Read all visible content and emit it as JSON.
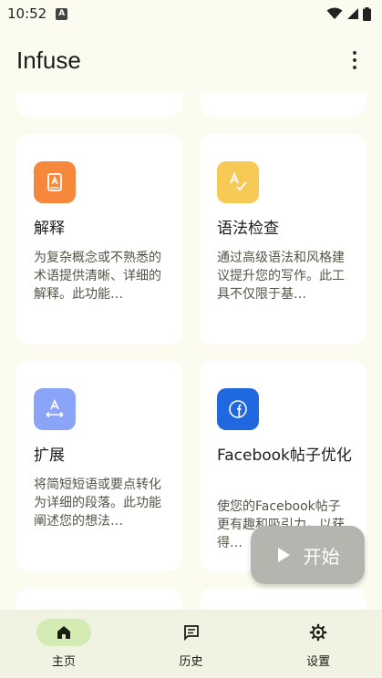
{
  "status_bar": {
    "time": "10:52",
    "notification_glyph": "A"
  },
  "app_bar": {
    "title": "Infuse",
    "menu_icon": "more-vert-icon"
  },
  "cards": [
    {
      "title": "解释",
      "description": "为复杂概念或不熟悉的术语提供清晰、详细的解释。此功能…",
      "icon": "book-icon",
      "icon_color": "#f6883b"
    },
    {
      "title": "语法检查",
      "description": "通过高级语法和风格建议提升您的写作。此工具不仅限于基…",
      "icon": "spellcheck-icon",
      "icon_color": "#f7ca56"
    },
    {
      "title": "扩展",
      "description": "将简短短语或要点转化为详细的段落。此功能阐述您的想法…",
      "icon": "expand-icon",
      "icon_color": "#8aa4f7"
    },
    {
      "title": "Facebook帖子优化",
      "description": "使您的Facebook帖子更有趣和吸引力，以获得…",
      "icon": "facebook-icon",
      "icon_color": "#1f68e0"
    }
  ],
  "fab": {
    "label": "开始",
    "icon": "play-icon"
  },
  "bottom_nav": {
    "items": [
      {
        "label": "主页",
        "icon": "home-icon",
        "active": true
      },
      {
        "label": "历史",
        "icon": "chat-icon",
        "active": false
      },
      {
        "label": "设置",
        "icon": "gear-icon",
        "active": false
      }
    ]
  },
  "colors": {
    "background": "#fbfcef",
    "card": "#ffffff",
    "nav_background": "#f1f3e2",
    "nav_active": "#d4ecb3",
    "fab": "#b4b5ae"
  }
}
